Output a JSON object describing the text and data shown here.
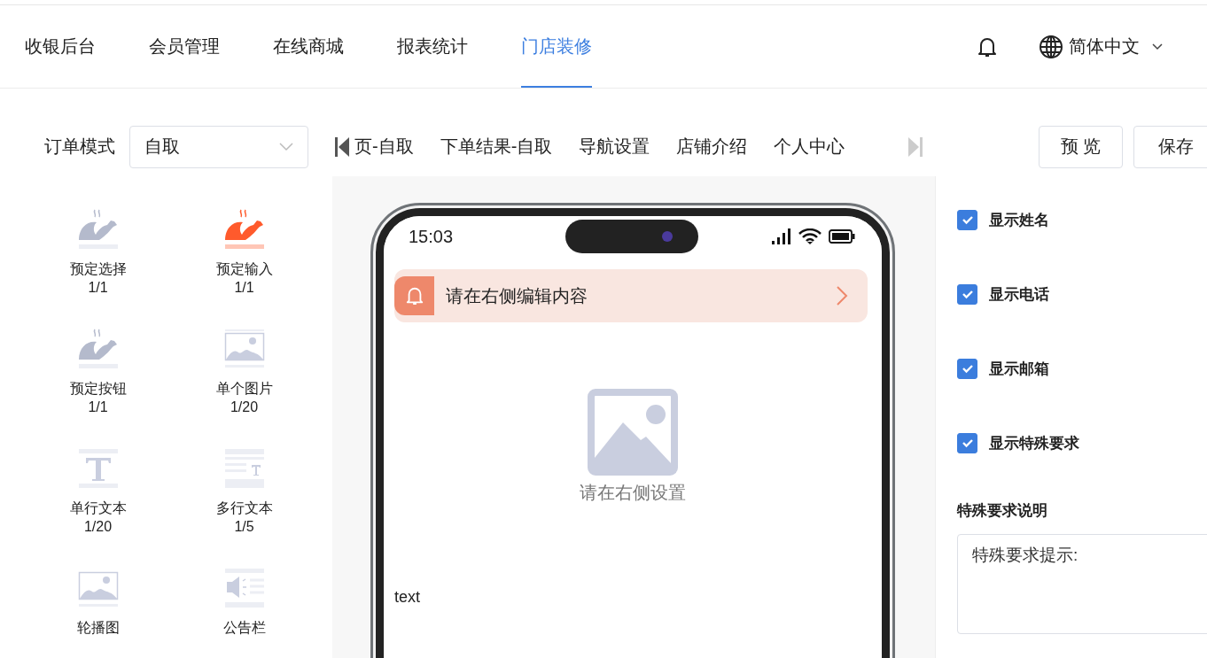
{
  "nav": {
    "tabs": [
      {
        "label": "收银后台",
        "selected": false
      },
      {
        "label": "会员管理",
        "selected": false
      },
      {
        "label": "在线商城",
        "selected": false
      },
      {
        "label": "报表统计",
        "selected": false
      },
      {
        "label": "门店装修",
        "selected": true
      }
    ],
    "language": "简体中文"
  },
  "toolbar": {
    "mode_label": "订单模式",
    "mode_select": {
      "value": "自取"
    },
    "page_tabs": [
      "页-自取",
      "下单结果-自取",
      "导航设置",
      "店铺介绍",
      "个人中心"
    ],
    "buttons": [
      "预 览",
      "保存"
    ]
  },
  "palette": [
    {
      "label": "预定选择",
      "count": "1/1",
      "kind": "dish",
      "selected": false
    },
    {
      "label": "预定输入",
      "count": "1/1",
      "kind": "dish",
      "selected": true
    },
    {
      "label": "预定按钮",
      "count": "1/1",
      "kind": "dish",
      "selected": false
    },
    {
      "label": "单个图片",
      "count": "1/20",
      "kind": "image",
      "selected": false
    },
    {
      "label": "单行文本",
      "count": "1/20",
      "kind": "text",
      "selected": false
    },
    {
      "label": "多行文本",
      "count": "1/5",
      "kind": "multiline",
      "selected": false
    },
    {
      "label": "轮播图",
      "kind": "carousel",
      "selected": false
    },
    {
      "label": "公告栏",
      "kind": "notice",
      "selected": false
    }
  ],
  "preview": {
    "time": "15:03",
    "notice": "请在右侧编辑内容",
    "image_hint": "请在右侧设置",
    "text": "text"
  },
  "settings": {
    "options": [
      {
        "label": "显示姓名",
        "checked": true
      },
      {
        "label": "显示电话",
        "checked": true
      },
      {
        "label": "显示邮箱",
        "checked": true
      },
      {
        "label": "显示特殊要求",
        "checked": true
      }
    ],
    "note_label": "特殊要求说明",
    "note": {
      "value": "特殊要求提示:"
    }
  }
}
